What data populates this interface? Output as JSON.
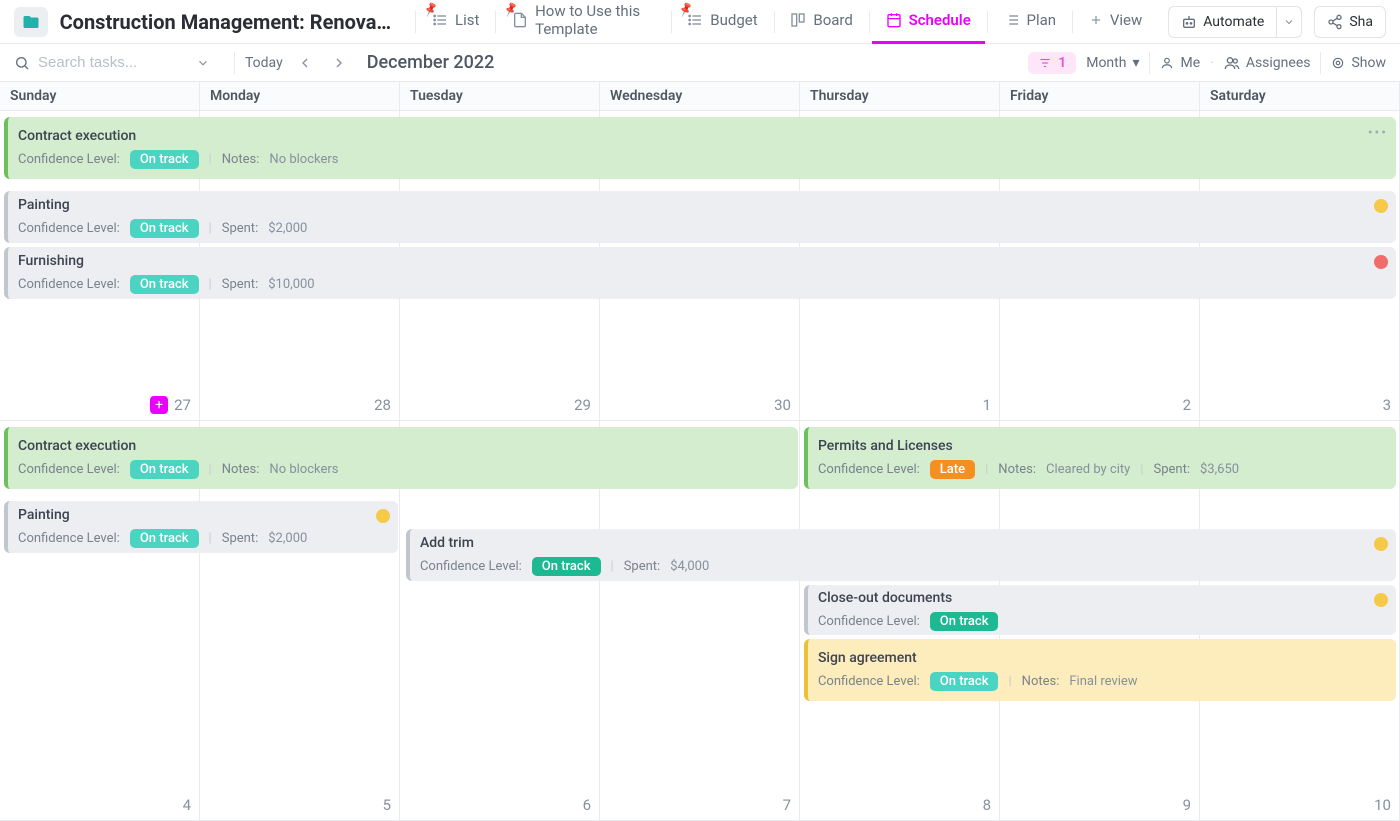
{
  "header": {
    "title": "Construction Management: Renovatio...",
    "views": [
      "List",
      "How to Use this Template",
      "Budget",
      "Board",
      "Schedule",
      "Plan"
    ],
    "add_view_label": "View",
    "automate_label": "Automate",
    "share_label": "Sha"
  },
  "toolbar": {
    "search_placeholder": "Search tasks...",
    "today_label": "Today",
    "month_year": "December 2022",
    "filter_count": "1",
    "scale_label": "Month",
    "me_label": "Me",
    "assignees_label": "Assignees",
    "show_label": "Show"
  },
  "days": [
    "Sunday",
    "Monday",
    "Tuesday",
    "Wednesday",
    "Thursday",
    "Friday",
    "Saturday"
  ],
  "weeks": [
    {
      "dates": [
        "27",
        "28",
        "29",
        "30",
        "1",
        "2",
        "3"
      ]
    },
    {
      "dates": [
        "4",
        "5",
        "6",
        "7",
        "8",
        "9",
        "10"
      ]
    }
  ],
  "common": {
    "conf_label": "Confidence Level:",
    "notes_label": "Notes:",
    "spent_label": "Spent:"
  },
  "tasks": {
    "contract1": {
      "title": "Contract execution",
      "pill": "On track",
      "notes": "No blockers"
    },
    "painting1": {
      "title": "Painting",
      "pill": "On track",
      "spent": "$2,000"
    },
    "furnishing": {
      "title": "Furnishing",
      "pill": "On track",
      "spent": "$10,000"
    },
    "contract2": {
      "title": "Contract execution",
      "pill": "On track",
      "notes": "No blockers"
    },
    "permits": {
      "title": "Permits and Licenses",
      "pill": "Late",
      "notes": "Cleared by city",
      "spent": "$3,650"
    },
    "painting2": {
      "title": "Painting",
      "pill": "On track",
      "spent": "$2,000"
    },
    "addtrim": {
      "title": "Add trim",
      "pill": "On track",
      "spent": "$4,000"
    },
    "closeout": {
      "title": "Close-out documents",
      "pill": "On track"
    },
    "sign": {
      "title": "Sign agreement",
      "pill": "On track",
      "notes": "Final review"
    }
  }
}
